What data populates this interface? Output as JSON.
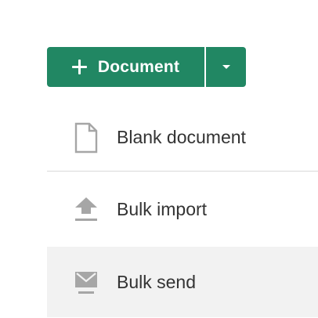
{
  "new_button": {
    "label": "Document",
    "icon": "plus-icon",
    "dropdown_icon": "caret-down-icon",
    "color": "#218763"
  },
  "menu": {
    "items": [
      {
        "label": "Blank document",
        "icon": "file-icon"
      },
      {
        "label": "Bulk import",
        "icon": "upload-icon"
      },
      {
        "label": "Bulk send",
        "icon": "envelope-tray-icon"
      }
    ]
  }
}
